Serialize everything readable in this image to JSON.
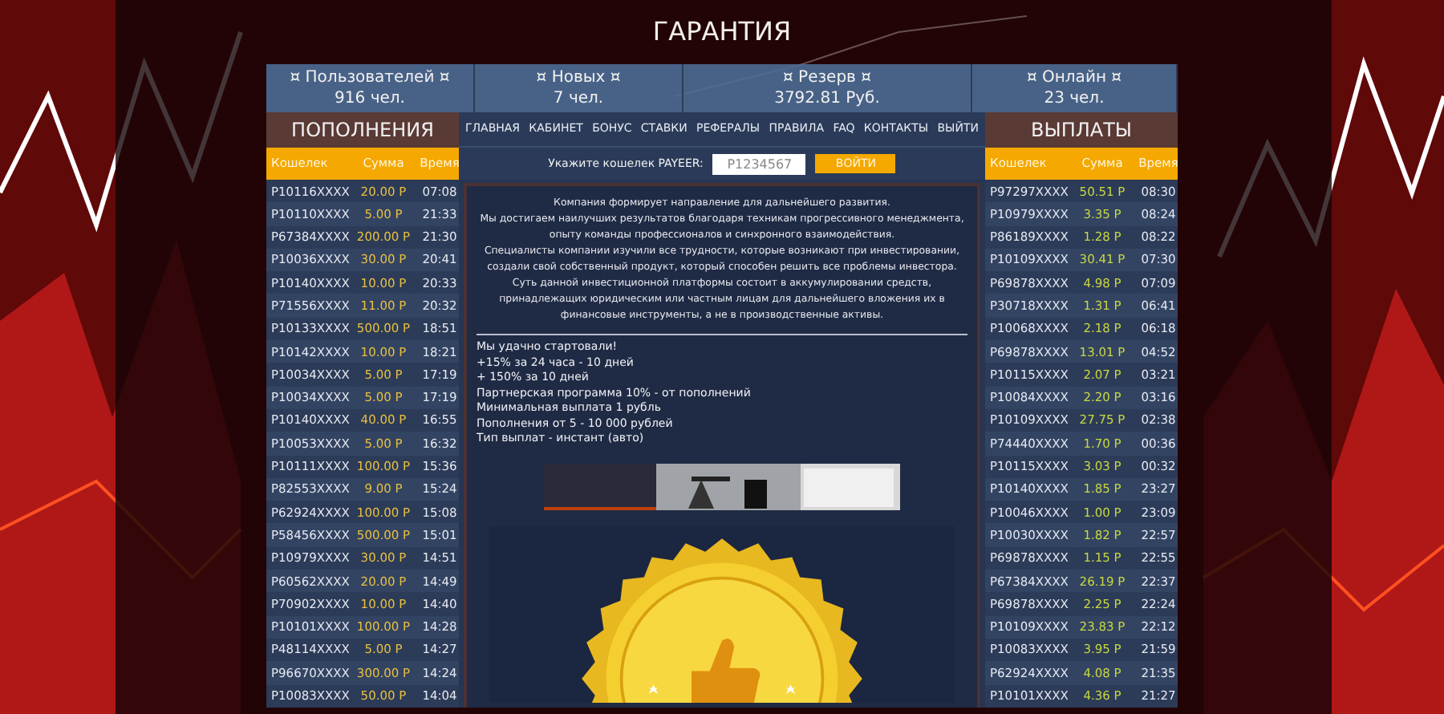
{
  "title": "ГАРАНТИЯ",
  "stats": [
    {
      "label": "¤ Пользователей ¤",
      "value": "916 чел."
    },
    {
      "label": "¤ Новых ¤",
      "value": "7 чел."
    },
    {
      "label": "¤ Резерв ¤",
      "value": "3792.81 Руб."
    },
    {
      "label": "¤ Онлайн ¤",
      "value": "23 чел."
    }
  ],
  "deposits": {
    "title": "ПОПОЛНЕНИЯ",
    "columns": [
      "Кошелек",
      "Сумма",
      "Время"
    ],
    "rows": [
      [
        "P10116XXXX",
        "20.00 Р",
        "07:08"
      ],
      [
        "P10110XXXX",
        "5.00 Р",
        "21:33"
      ],
      [
        "P67384XXXX",
        "200.00 Р",
        "21:30"
      ],
      [
        "P10036XXXX",
        "30.00 Р",
        "20:41"
      ],
      [
        "P10140XXXX",
        "10.00 Р",
        "20:33"
      ],
      [
        "P71556XXXX",
        "11.00 Р",
        "20:32"
      ],
      [
        "P10133XXXX",
        "500.00 Р",
        "18:51"
      ],
      [
        "P10142XXXX",
        "10.00 Р",
        "18:21"
      ],
      [
        "P10034XXXX",
        "5.00 Р",
        "17:19"
      ],
      [
        "P10034XXXX",
        "5.00 Р",
        "17:19"
      ],
      [
        "P10140XXXX",
        "40.00 Р",
        "16:55"
      ],
      [
        "P10053XXXX",
        "5.00 Р",
        "16:32"
      ],
      [
        "P10111XXXX",
        "100.00 Р",
        "15:36"
      ],
      [
        "P82553XXXX",
        "9.00 Р",
        "15:24"
      ],
      [
        "P62924XXXX",
        "100.00 Р",
        "15:08"
      ],
      [
        "P58456XXXX",
        "500.00 Р",
        "15:01"
      ],
      [
        "P10979XXXX",
        "30.00 Р",
        "14:51"
      ],
      [
        "P60562XXXX",
        "20.00 Р",
        "14:49"
      ],
      [
        "P70902XXXX",
        "10.00 Р",
        "14:40"
      ],
      [
        "P10101XXXX",
        "100.00 Р",
        "14:28"
      ],
      [
        "P48114XXXX",
        "5.00 Р",
        "14:27"
      ],
      [
        "P96670XXXX",
        "300.00 Р",
        "14:24"
      ],
      [
        "P10083XXXX",
        "50.00 Р",
        "14:04"
      ]
    ]
  },
  "nav": [
    "ГЛАВНАЯ",
    "КАБИНЕТ",
    "БОНУС",
    "СТАВКИ",
    "РЕФЕРАЛЫ",
    "ПРАВИЛА",
    "FAQ",
    "КОНТАКТЫ",
    "ВЫЙТИ"
  ],
  "login": {
    "label": "Укажите кошелек PAYEER:",
    "placeholder": "P1234567",
    "button": "ВОЙТИ"
  },
  "about": [
    "Компания формирует направление для дальнейшего развития.",
    "Мы достигаем наилучших результатов благодаря техникам прогрессивного менеджмента,",
    "опыту команды профессионалов и синхронного взаимодействия.",
    "Специалисты компании изучили все трудности, которые возникают при инвестировании,",
    "создали свой собственный продукт, который способен решить все проблемы инвестора.",
    "Суть данной инвестиционной платформы состоит в аккумулировании средств,",
    "принадлежащих юридическим или частным лицам для дальнейшего вложения их в",
    "финансовые инструменты, а не в производственные активы."
  ],
  "terms": [
    "Мы удачно стартовали!",
    "+15% за 24 часа - 10 дней",
    "+ 150% за 10 дней",
    "Партнерская программа 10% - от пополнений",
    "Минимальная выплата 1 рубль",
    "Пополнения от 5 - 10 000 рублей",
    "Тип выплат - инстант (авто)"
  ],
  "payouts": {
    "title": "ВЫПЛАТЫ",
    "columns": [
      "Кошелек",
      "Сумма",
      "Время"
    ],
    "rows": [
      [
        "P97297XXXX",
        "50.51 Р",
        "08:30"
      ],
      [
        "P10979XXXX",
        "3.35 Р",
        "08:24"
      ],
      [
        "P86189XXXX",
        "1.28 Р",
        "08:22"
      ],
      [
        "P10109XXXX",
        "30.41 Р",
        "07:30"
      ],
      [
        "P69878XXXX",
        "4.98 Р",
        "07:09"
      ],
      [
        "P30718XXXX",
        "1.31 Р",
        "06:41"
      ],
      [
        "P10068XXXX",
        "2.18 Р",
        "06:18"
      ],
      [
        "P69878XXXX",
        "13.01 Р",
        "04:52"
      ],
      [
        "P10115XXXX",
        "2.07 Р",
        "03:21"
      ],
      [
        "P10084XXXX",
        "2.20 Р",
        "03:16"
      ],
      [
        "P10109XXXX",
        "27.75 Р",
        "02:38"
      ],
      [
        "P74440XXXX",
        "1.70 Р",
        "00:36"
      ],
      [
        "P10115XXXX",
        "3.03 Р",
        "00:32"
      ],
      [
        "P10140XXXX",
        "1.85 Р",
        "23:27"
      ],
      [
        "P10046XXXX",
        "1.00 Р",
        "23:09"
      ],
      [
        "P10030XXXX",
        "1.82 Р",
        "22:57"
      ],
      [
        "P69878XXXX",
        "1.15 Р",
        "22:55"
      ],
      [
        "P67384XXXX",
        "26.19 Р",
        "22:37"
      ],
      [
        "P69878XXXX",
        "2.25 Р",
        "22:24"
      ],
      [
        "P10109XXXX",
        "23.83 Р",
        "22:12"
      ],
      [
        "P10083XXXX",
        "3.95 Р",
        "21:59"
      ],
      [
        "P62924XXXX",
        "4.08 Р",
        "21:35"
      ],
      [
        "P10101XXXX",
        "4.36 Р",
        "21:27"
      ]
    ]
  }
}
